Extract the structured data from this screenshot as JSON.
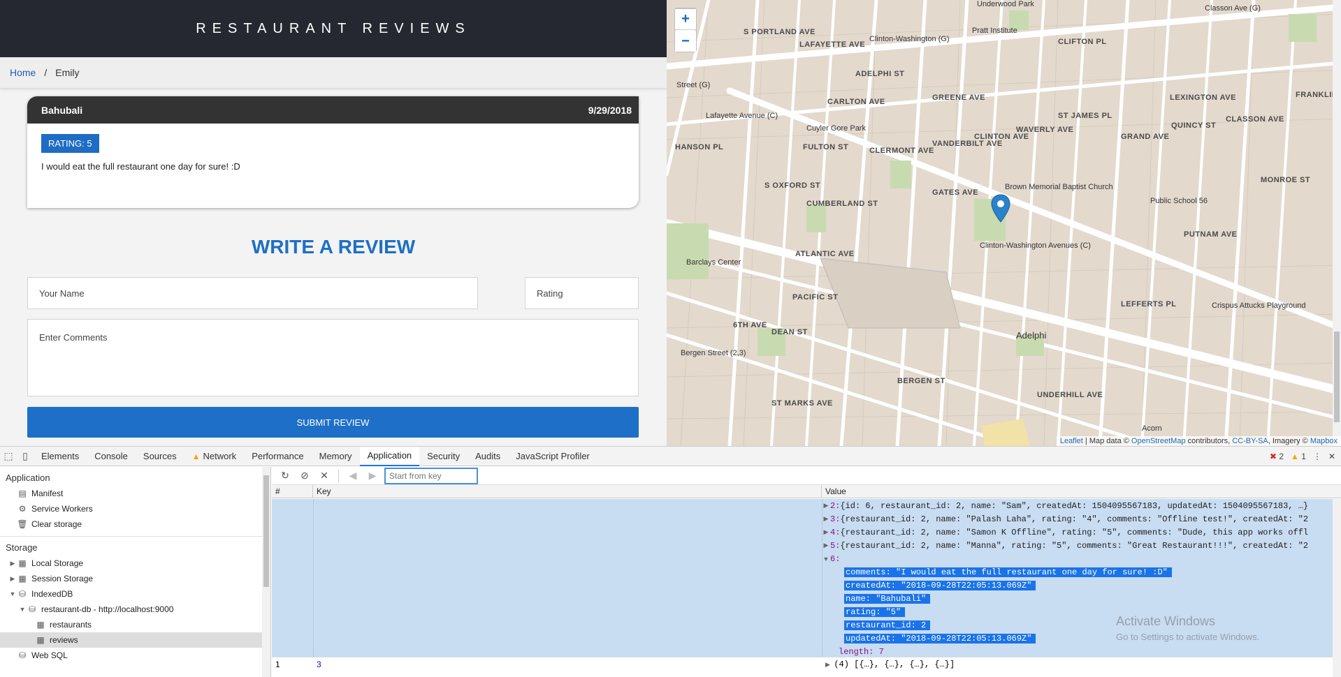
{
  "site": {
    "title": "RESTAURANT REVIEWS"
  },
  "breadcrumb": {
    "home": "Home",
    "sep": "/",
    "current": "Emily"
  },
  "review": {
    "name": "Bahubali",
    "date": "9/29/2018",
    "rating": "RATING: 5",
    "comments": "I would eat the full restaurant one day for sure! :D"
  },
  "form": {
    "title": "WRITE A REVIEW",
    "name_placeholder": "Your Name",
    "rating_placeholder": "Rating",
    "comments_placeholder": "Enter Comments",
    "submit_label": "SUBMIT REVIEW"
  },
  "map": {
    "zoom_in": "+",
    "zoom_out": "−",
    "attribution": {
      "leaflet": "Leaflet",
      "text1": " | Map data © ",
      "osm": "OpenStreetMap",
      "text2": " contributors, ",
      "license": "CC-BY-SA",
      "text3": ", Imagery © ",
      "mapbox": "Mapbox"
    },
    "labels": [
      "Lafayette Avenue (C)",
      "Cuyler Gore Park",
      "Brown Memorial Baptist Church",
      "Clinton-Washington Avenues (C)",
      "Barclays Center",
      "Public School 56",
      "Bergen Street (2,3)",
      "Adelphi",
      "Crispus Attucks Playground",
      "Acorn",
      "Pratt Institute",
      "Classon Ave (G)",
      "Clinton-Washington (G)",
      "Underwood Park",
      "Street (G)"
    ],
    "streets": [
      "LAFAYETTE AVE",
      "GREENE AVE",
      "FULTON ST",
      "ATLANTIC AVE",
      "PACIFIC ST",
      "DEAN ST",
      "BERGEN ST",
      "ST MARKS AVE",
      "GATES AVE",
      "CLIFTON PL",
      "LEXINGTON AVE",
      "QUINCY ST",
      "MONROE ST",
      "PUTNAM AVE",
      "LEFFERTS PL",
      "CLERMONT AVE",
      "VANDERBILT AVE",
      "CLINTON AVE",
      "WAVERLY AVE",
      "ST JAMES PL",
      "GRAND AVE",
      "CLASSON AVE",
      "FRANKLIN AVE",
      "S OXFORD ST",
      "CARLTON AVE",
      "S PORTLAND AVE",
      "CUMBERLAND ST",
      "ADELPHI ST",
      "6TH AVE",
      "UNDERHILL AVE",
      "HANSON PL"
    ]
  },
  "devtools": {
    "tabs": [
      "Elements",
      "Console",
      "Sources",
      "Network",
      "Performance",
      "Memory",
      "Application",
      "Security",
      "Audits",
      "JavaScript Profiler"
    ],
    "active_tab": "Application",
    "errors": "2",
    "warnings": "1",
    "sidebar": {
      "application_header": "Application",
      "manifest": "Manifest",
      "service_workers": "Service Workers",
      "clear_storage": "Clear storage",
      "storage_header": "Storage",
      "local_storage": "Local Storage",
      "session_storage": "Session Storage",
      "indexeddb": "IndexedDB",
      "db": "restaurant-db - http://localhost:9000",
      "store1": "restaurants",
      "store2": "reviews",
      "websql": "Web SQL"
    },
    "key_placeholder": "Start from key",
    "columns": {
      "num": "#",
      "key": "Key",
      "value": "Value"
    },
    "value_lines": [
      {
        "idx": "2:",
        "text": " {id: 6, restaurant_id: 2, name: \"Sam\", createdAt: 1504095567183, updatedAt: 1504095567183, …}"
      },
      {
        "idx": "3:",
        "text": " {restaurant_id: 2, name: \"Palash Laha\", rating: \"4\", comments: \"Offline test!\", createdAt: \"2"
      },
      {
        "idx": "4:",
        "text": " {restaurant_id: 2, name: \"Samon K Offline\", rating: \"5\", comments: \"Dude, this app works offl"
      },
      {
        "idx": "5:",
        "text": " {restaurant_id: 2, name: \"Manna\", rating: \"5\", comments: \"Great Restaurant!!!\", createdAt: \"2"
      },
      {
        "idx": "6:",
        "text": ""
      }
    ],
    "selected_lines": [
      "comments: \"I would eat the full restaurant one day for sure! :D\"",
      "createdAt: \"2018-09-28T22:05:13.069Z\"",
      "name: \"Bahubali\"",
      "rating: \"5\"",
      "restaurant_id: 2",
      "updatedAt: \"2018-09-28T22:05:13.069Z\""
    ],
    "length_line": "length: 7",
    "row2": {
      "num": "1",
      "key": "3",
      "value": "(4) [{…}, {…}, {…}, {…}]"
    },
    "watermark": {
      "line1": "Activate Windows",
      "line2": "Go to Settings to activate Windows."
    }
  }
}
